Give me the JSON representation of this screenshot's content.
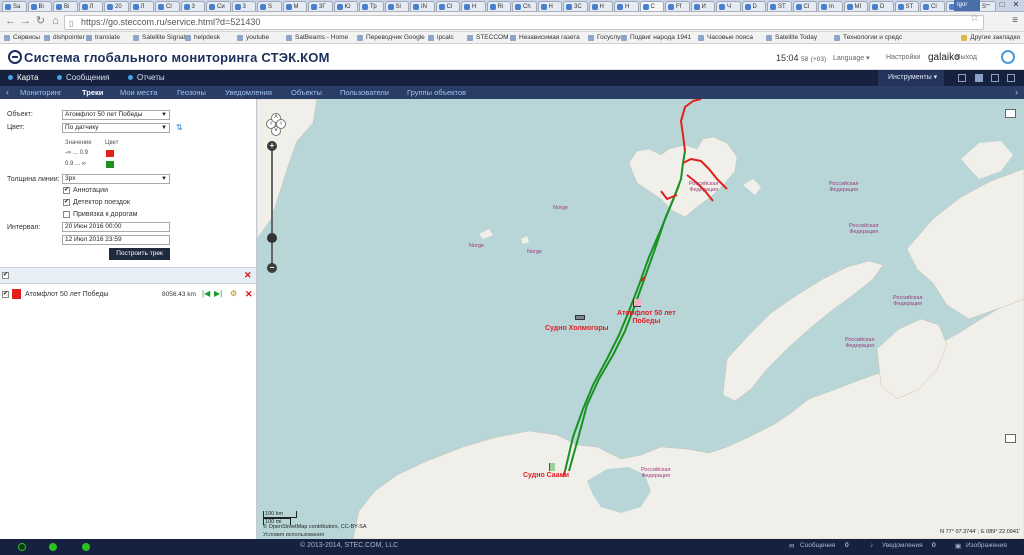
{
  "browser": {
    "tabs": [
      "Sa",
      "Bi",
      "Bi",
      "Л",
      "20",
      "Л",
      "Cl",
      "3",
      "Си",
      "3",
      "S",
      "М",
      "3Г",
      "Ю",
      "Тр",
      "Sl",
      "IN",
      "Cl",
      "Н",
      "Ri",
      "Ch",
      "Н",
      "3С",
      "Н",
      "Н",
      "С",
      "Ff",
      "И",
      "Ч",
      "D",
      "ST",
      "Cl",
      "In",
      "MI",
      "D",
      "ST",
      "Cl",
      "S",
      "S"
    ],
    "user_chip": "Igor",
    "url": "https://go.steccom.ru/service.html?d=521430",
    "bookmarks": [
      "Сервисы",
      "dishpointer",
      "translate",
      "Satellite Signals",
      "helpdesk",
      "youtube",
      "SatBeams - Home",
      "Переводчик Google",
      "ipcalc",
      "STECCOM",
      "Независимая газета",
      "Госуслуги",
      "Подвиг народа 1941",
      "Часовые пояса",
      "Satellite Today",
      "Технологии и средс"
    ],
    "bookmarks_other": "Другие закладки"
  },
  "header": {
    "logo": "Система глобального мониторинга СТЭК.КОМ",
    "time": "15:04",
    "seconds": "58",
    "tz": "(+03)",
    "language": "Language ▾",
    "settings": "Настройки",
    "username": "galaiko",
    "logout": "Выход"
  },
  "main_nav": {
    "items": [
      "Карта",
      "Сообщения",
      "Отчеты"
    ],
    "tools": "Инструменты ▾"
  },
  "sub_nav": {
    "items": [
      "Мониторинг",
      "Треки",
      "Мои места",
      "Геозоны",
      "Уведомления",
      "Объекты",
      "Пользователи",
      "Группы объектов"
    ]
  },
  "panel": {
    "object_label": "Объект:",
    "object_value": "Атомфлот 50 лет Победы",
    "color_label": "Цвет:",
    "color_value": "По датчику",
    "value_header": "Значение",
    "color_header": "Цвет",
    "range1": "-∞ ... 0.9",
    "range2": "0.9 ... ∞",
    "range1_color": "#e0201b",
    "range2_color": "#199222",
    "width_label": "Толщина линии:",
    "width_value": "3px",
    "annotations": "Аннотации",
    "trip_detector": "Детектор поездок",
    "road_snap": "Привязка к дорогам",
    "interval_label": "Интервал:",
    "date_from": "20 Июн 2016 00:00",
    "date_to": "12 Июл 2016 23:59",
    "build_button": "Построить трек",
    "track_name": "Атомфлот 50 лет Победы",
    "track_distance": "8056.43 km",
    "track_color": "#e0201b"
  },
  "map": {
    "places": {
      "norge_sv": "Norge",
      "norge_jm": "Norge",
      "norge_bi": "Norge",
      "rf_fj": "Российская\nФедерация",
      "rf_sz": "Российская\nФедерация",
      "rf_nz": "Российская\nФедерация",
      "rf_kara": "Российская\nФедерация",
      "rf_land": "Российская\nФедерация"
    },
    "vessels": {
      "atomflot": "Атомфлот 50 лет\nПобеды",
      "holmogory": "Судно Холмогоры",
      "saami": "Судно Саами"
    },
    "scale_km": "100 km",
    "scale_mi": "100 mi",
    "attribution": "© OpenStreetMap contributors, CC-BY-SA",
    "terms": "Условия использования",
    "coords": "N 77° 07.3744' ; E 089° 22.0941'",
    "track_green": "#199222",
    "track_red": "#e0201b"
  },
  "statusbar": {
    "copyright": "© 2013-2014, STEC.COM, LLC",
    "messages": "Сообщения",
    "messages_count": "0",
    "notifications": "Уведомления",
    "notifications_count": "0",
    "images": "Изображения"
  }
}
